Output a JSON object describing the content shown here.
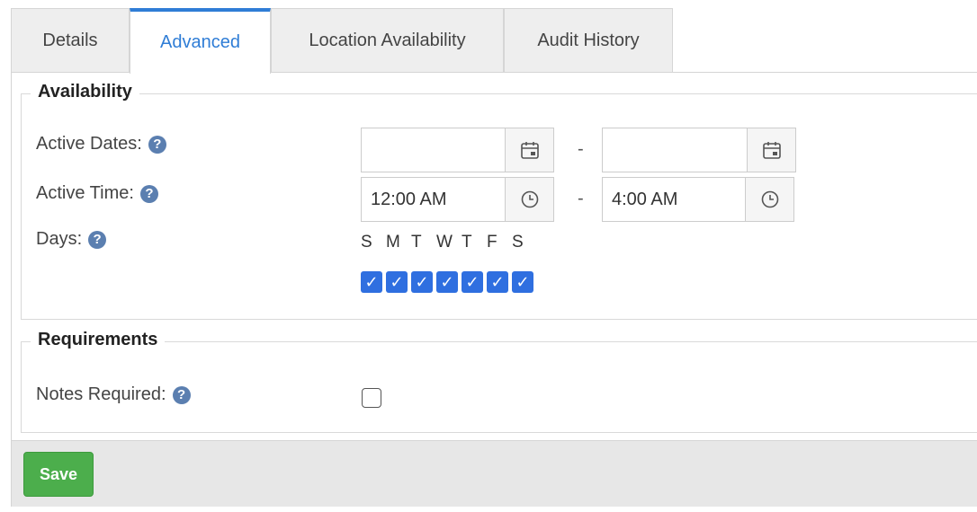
{
  "tabs": [
    {
      "label": "Details"
    },
    {
      "label": "Advanced"
    },
    {
      "label": "Location Availability"
    },
    {
      "label": "Audit History"
    }
  ],
  "active_tab": "Advanced",
  "availability": {
    "legend": "Availability",
    "active_dates": {
      "label": "Active Dates:",
      "start_value": "",
      "end_value": "",
      "separator": "-"
    },
    "active_time": {
      "label": "Active Time:",
      "start_value": "12:00 AM",
      "end_value": "4:00 AM",
      "separator": "-"
    },
    "days": {
      "label": "Days:",
      "letters": [
        "S",
        "M",
        "T",
        "W",
        "T",
        "F",
        "S"
      ],
      "checked": [
        true,
        true,
        true,
        true,
        true,
        true,
        true
      ]
    }
  },
  "requirements": {
    "legend": "Requirements",
    "notes_required": {
      "label": "Notes Required:",
      "checked": false
    }
  },
  "help_glyph": "?",
  "check_glyph": "✓",
  "footer": {
    "save_label": "Save"
  },
  "colors": {
    "accent": "#2f7dd6",
    "save": "#4cae4c",
    "checkbox": "#2f6fe0",
    "help": "#5b7fb0"
  }
}
